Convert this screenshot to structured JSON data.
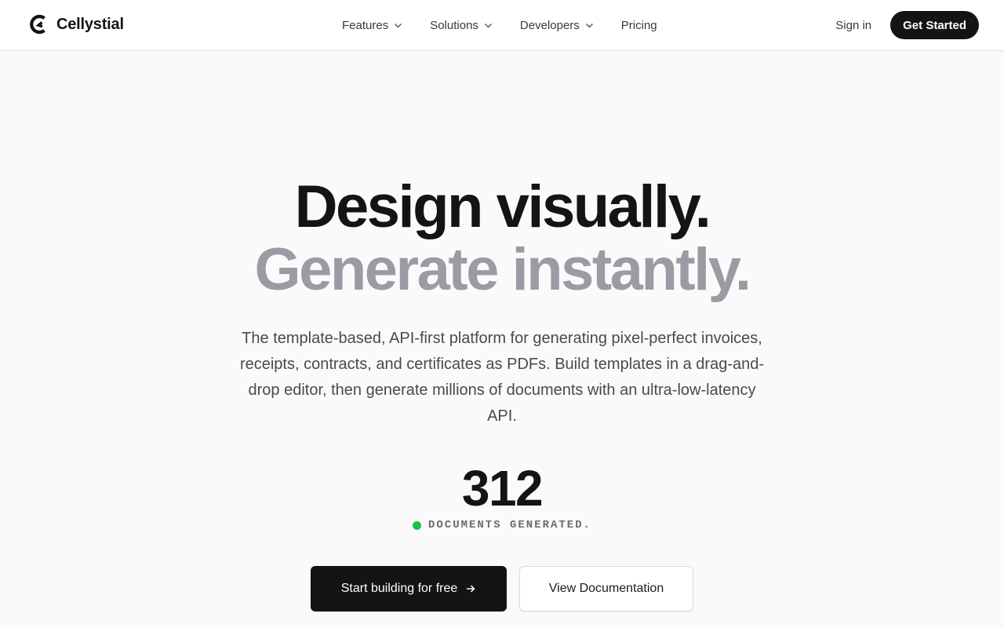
{
  "header": {
    "brand": {
      "name": "Cellystial",
      "logo_icon": "cellystial-logo-icon"
    },
    "nav": [
      {
        "label": "Features",
        "has_dropdown": true
      },
      {
        "label": "Solutions",
        "has_dropdown": true
      },
      {
        "label": "Developers",
        "has_dropdown": true
      },
      {
        "label": "Pricing",
        "has_dropdown": false
      }
    ],
    "sign_in_label": "Sign in",
    "get_started_label": "Get Started"
  },
  "hero": {
    "headline_line1": "Design visually.",
    "headline_line2": "Generate instantly.",
    "subtitle": "The template-based, API-first platform for generating pixel-perfect invoices, receipts, contracts, and certificates as PDFs. Build templates in a drag-and-drop editor, then generate millions of documents with an ultra-low-latency API.",
    "counter_value": "312",
    "counter_label": "DOCUMENTS GENERATED.",
    "primary_cta": "Start building for free",
    "secondary_cta": "View Documentation"
  },
  "colors": {
    "page_background": "#fafafa",
    "text_primary": "#141414",
    "headline_muted": "#9b9ca3",
    "live_indicator": "#1fbf4b",
    "button_dark": "#141414"
  }
}
